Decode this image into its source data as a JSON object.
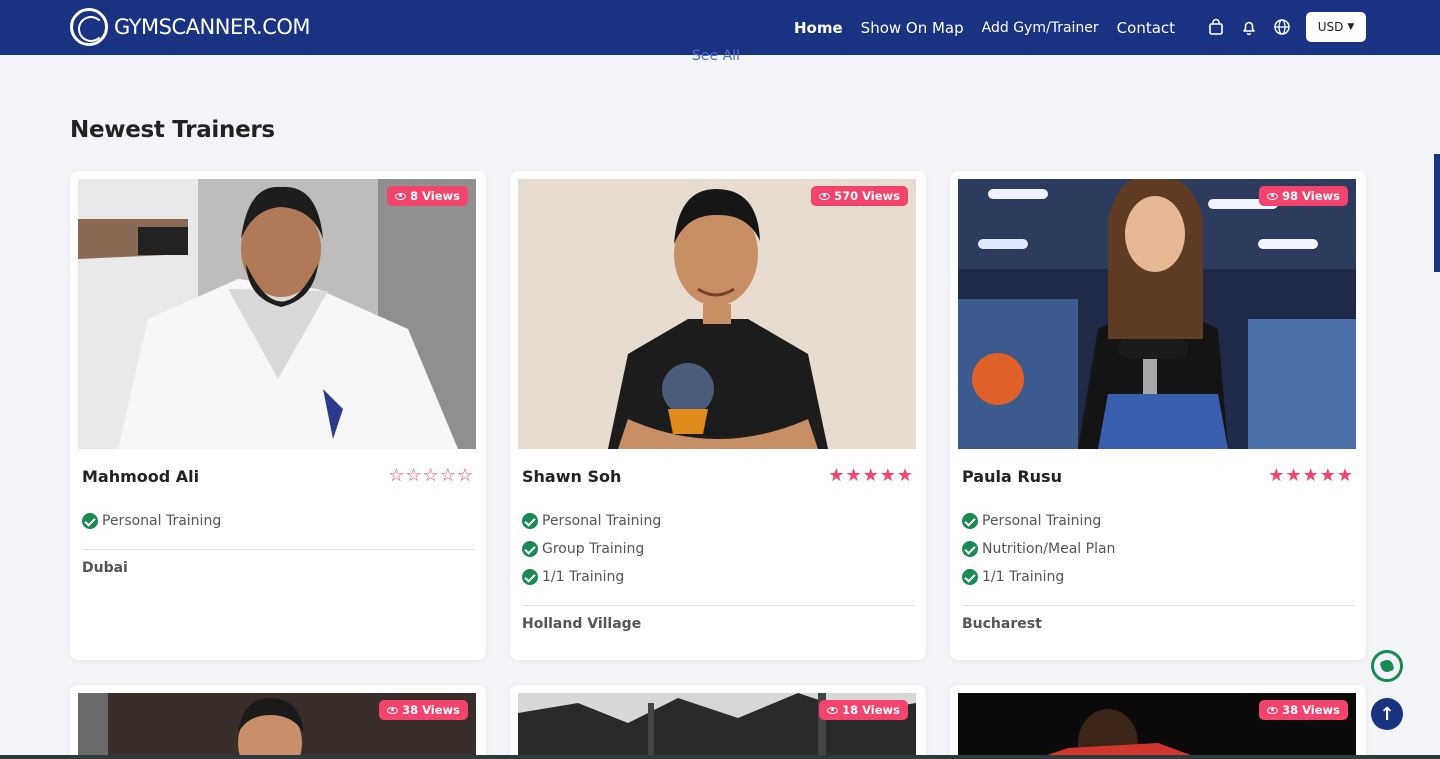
{
  "brand": {
    "name": "GYMSCANNER.COM"
  },
  "nav": {
    "links": [
      "Home",
      "Show On Map",
      "Add Gym/Trainer",
      "Contact"
    ],
    "icons": [
      "shopping-bag-icon",
      "bell-icon",
      "globe-icon"
    ],
    "currency": "USD"
  },
  "see_all": "See All",
  "section_title": "Newest Trainers",
  "trainers": [
    {
      "name": "Mahmood Ali",
      "views": "8 Views",
      "rating": 0,
      "services": [
        "Personal Training"
      ],
      "location": "Dubai"
    },
    {
      "name": "Shawn Soh",
      "views": "570 Views",
      "rating": 5,
      "services": [
        "Personal Training",
        "Group Training",
        "1/1 Training"
      ],
      "location": "Holland Village"
    },
    {
      "name": "Paula Rusu",
      "views": "98 Views",
      "rating": 5,
      "services": [
        "Personal Training",
        "Nutrition/Meal Plan",
        "1/1 Training"
      ],
      "location": "Bucharest"
    }
  ],
  "next_row_views": [
    "38 Views",
    "18 Views",
    "38 Views"
  ],
  "colors": {
    "navbar": "#1a3282",
    "accent": "#f2446d",
    "check": "#1a8a53",
    "link": "#4f6fd8"
  }
}
